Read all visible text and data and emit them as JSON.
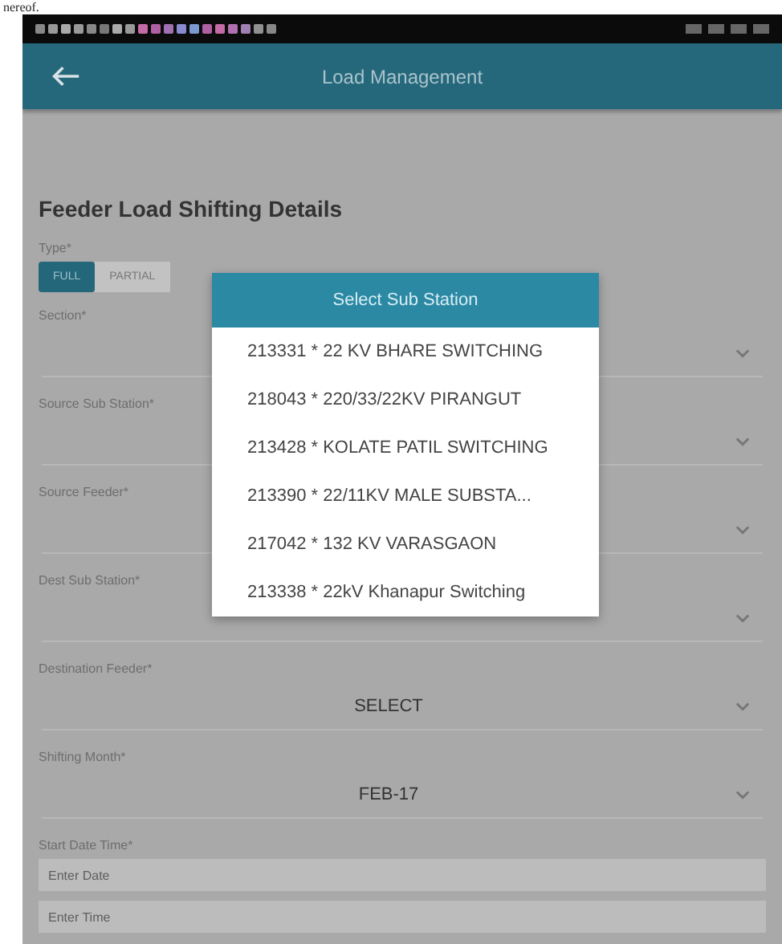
{
  "page_fragment": "nereof.",
  "app_bar": {
    "title": "Load Management"
  },
  "form": {
    "title": "Feeder Load Shifting Details",
    "fields": [
      {
        "kind": "toggle",
        "label": "Type*",
        "options": [
          {
            "label": "FULL",
            "selected": true
          },
          {
            "label": "PARTIAL",
            "selected": false
          }
        ]
      },
      {
        "kind": "select",
        "label": "Section*"
      },
      {
        "kind": "select",
        "label": "Source Sub Station*"
      },
      {
        "kind": "select",
        "label": "Source Feeder*"
      },
      {
        "kind": "select",
        "label": "Dest Sub Station*"
      },
      {
        "kind": "select",
        "label": "Destination Feeder*",
        "value": "SELECT"
      },
      {
        "kind": "select",
        "label": "Shifting Month*",
        "value": "FEB-17"
      },
      {
        "kind": "inputs",
        "label": "Start Date Time*",
        "placeholders": [
          "Enter Date",
          "Enter Time"
        ]
      }
    ]
  },
  "dialog": {
    "title": "Select Sub Station",
    "items": [
      "213331 * 22 KV BHARE SWITCHING",
      "218043 * 220/33/22KV PIRANGUT",
      "213428 * KOLATE PATIL SWITCHING",
      "213390 * 22/11KV MALE SUBSTA...",
      "217042 * 132 KV VARASGAON",
      "213338 * 22kV Khanapur Switching"
    ]
  }
}
